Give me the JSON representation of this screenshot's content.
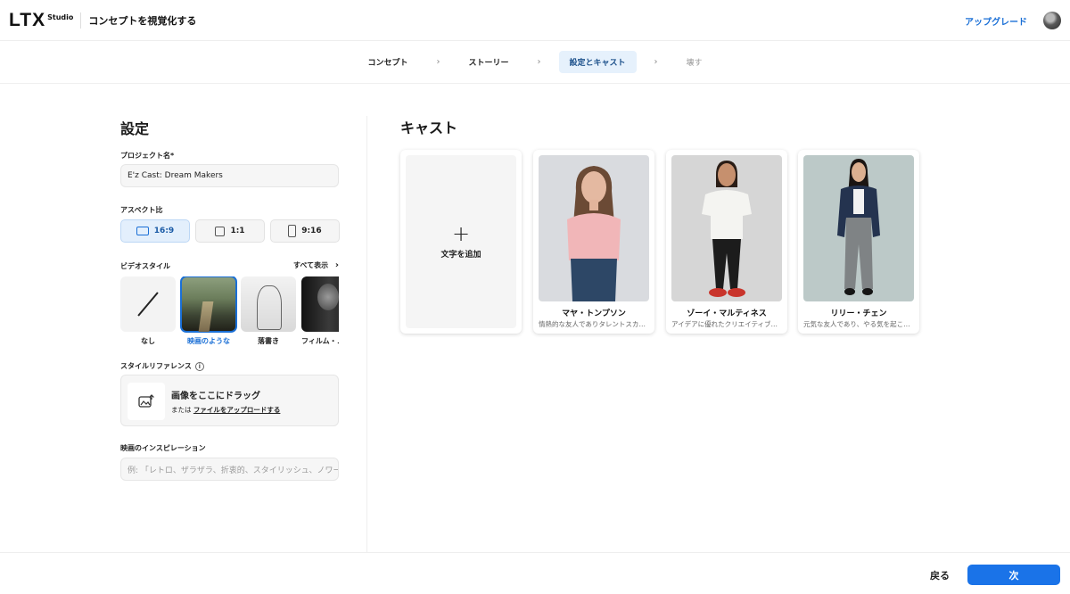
{
  "header": {
    "logo": "LTX",
    "logo_sub": "Studio",
    "title": "コンセプトを視覚化する",
    "upgrade_label": "アップグレード"
  },
  "steps": [
    {
      "label": "コンセプト"
    },
    {
      "label": "ストーリー"
    },
    {
      "label": "設定とキャスト"
    },
    {
      "label": "壊す"
    }
  ],
  "settings": {
    "title": "設定",
    "project_name_label": "プロジェクト名*",
    "project_name_value": "E'z Cast: Dream Makers",
    "aspect_label": "アスペクト比",
    "aspect_options": [
      {
        "label": "16:9"
      },
      {
        "label": "1:1"
      },
      {
        "label": "9:16"
      }
    ],
    "aspect_selected": "16:9",
    "video_style_label": "ビデオスタイル",
    "show_all_label": "すべて表示",
    "styles": [
      {
        "label": "なし"
      },
      {
        "label": "映画のような"
      },
      {
        "label": "落書き"
      },
      {
        "label": "フィルム・ノワール"
      }
    ],
    "style_selected": "映画のような",
    "style_ref_label": "スタイルリファレンス",
    "dropzone_title": "画像をここにドラッグ",
    "dropzone_prefix": "または",
    "dropzone_link": "ファイルをアップロードする",
    "inspiration_label": "映画のインスピレーション",
    "inspiration_placeholder": "例: 「レトロ、ザラザラ、折衷的、スタイリッシュ、ノワール」"
  },
  "cast": {
    "title": "キャスト",
    "add_label": "文字を追加",
    "members": [
      {
        "name": "マヤ・トンプソン",
        "desc": "情熱的な友人でありタレントスカウト"
      },
      {
        "name": "ゾーイ・マルティネス",
        "desc": "アイデアに優れたクリエイティブな友人"
      },
      {
        "name": "リリー・チェン",
        "desc": "元気な友人であり、やる気を起こさせる"
      }
    ]
  },
  "footer": {
    "back_label": "戻る",
    "next_label": "次"
  },
  "colors": {
    "accent": "#1a73e8",
    "selected_bg": "#e3effc"
  }
}
